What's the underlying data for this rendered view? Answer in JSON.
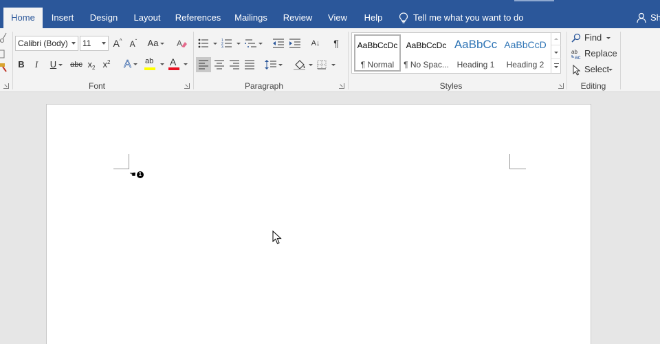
{
  "tabs": [
    {
      "label": "Home",
      "active": true
    },
    {
      "label": "Insert"
    },
    {
      "label": "Design"
    },
    {
      "label": "Layout"
    },
    {
      "label": "References"
    },
    {
      "label": "Mailings"
    },
    {
      "label": "Review"
    },
    {
      "label": "View"
    },
    {
      "label": "Help"
    }
  ],
  "tell_me": "Tell me what you want to do",
  "share_label": "Sh",
  "font": {
    "name": "Calibri (Body)",
    "size": "11",
    "grow_glyph": "A",
    "shrink_glyph": "A",
    "case_glyph": "Aa",
    "bold": "B",
    "italic": "I",
    "underline": "U",
    "strike": "abc",
    "subscript": "x",
    "subscript_mark": "2",
    "superscript": "x",
    "superscript_mark": "2",
    "effects_glyph": "A",
    "highlight_glyph": "ab",
    "font_color_glyph": "A",
    "group_label": "Font"
  },
  "paragraph": {
    "sort_glyph": "A↓",
    "pilcrow": "¶",
    "group_label": "Paragraph"
  },
  "styles": {
    "items": [
      {
        "preview": "AaBbCcDc",
        "name": "¶ Normal",
        "selected": true
      },
      {
        "preview": "AaBbCcDc",
        "name": "¶ No Spac..."
      },
      {
        "preview": "AaBbCc",
        "name": "Heading 1"
      },
      {
        "preview": "AaBbCcD",
        "name": "Heading 2"
      }
    ],
    "group_label": "Styles"
  },
  "editing": {
    "find": "Find",
    "replace": "Replace",
    "replace_icon_text": "ab",
    "select": "Select",
    "group_label": "Editing"
  },
  "document": {
    "marker_number": "1"
  },
  "colors": {
    "tab_bar": "#2b579a",
    "ribbon": "#f3f3f3",
    "highlight": "#ffff00",
    "font_color": "#e81123",
    "heading": "#2e74b5"
  }
}
